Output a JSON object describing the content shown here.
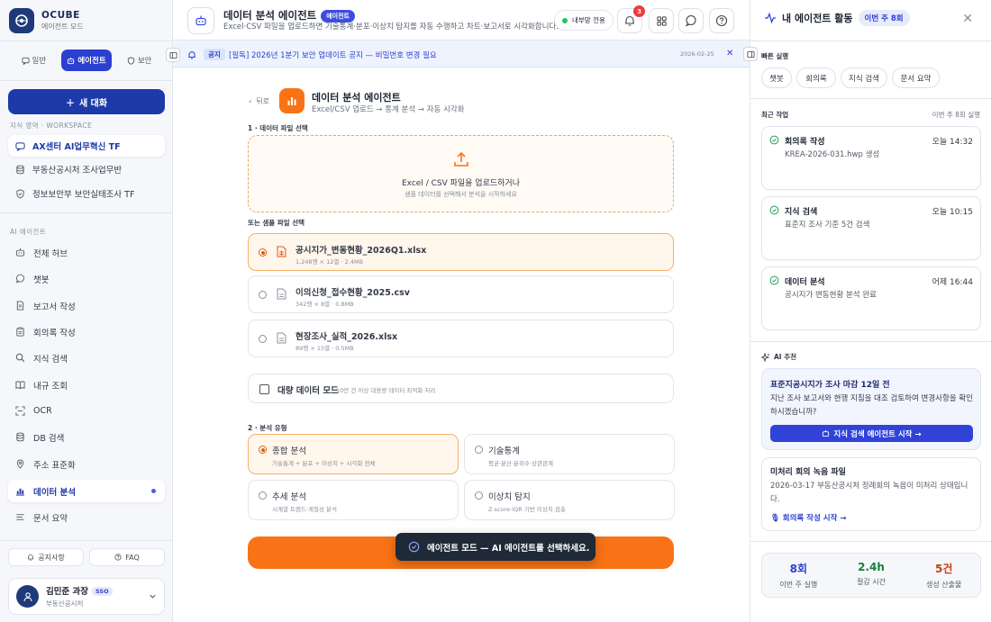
{
  "brand": {
    "name": "OCUBE",
    "subtitle": "에이전트 모드"
  },
  "sidebar": {
    "modes": [
      {
        "label": "일반",
        "icon": "chat-icon",
        "active": false
      },
      {
        "label": "에이전트",
        "icon": "robot-icon",
        "active": true
      },
      {
        "label": "보안",
        "icon": "shield-icon",
        "active": false
      }
    ],
    "new_chat_label": "새 대화",
    "workspace_label": "지식 영역 · WORKSPACE",
    "workspaces": [
      {
        "label": "AX센터 AI업무혁신 TF",
        "icon": "chat-icon",
        "active": true
      },
      {
        "label": "부동산공시처 조사업무반",
        "icon": "database-icon",
        "active": false
      },
      {
        "label": "정보보안부 보안실태조사 TF",
        "icon": "shield-icon",
        "active": false
      }
    ],
    "agents_label": "AI 에이전트",
    "agents": [
      {
        "label": "전체 허브",
        "icon": "robot-icon"
      },
      {
        "label": "챗봇",
        "icon": "chat-icon"
      },
      {
        "label": "보고서 작성",
        "icon": "document-icon"
      },
      {
        "label": "회의록 작성",
        "icon": "clipboard-icon"
      },
      {
        "label": "지식 검색",
        "icon": "search-icon"
      },
      {
        "label": "내규 조회",
        "icon": "book-icon"
      },
      {
        "label": "OCR",
        "icon": "scan-icon"
      },
      {
        "label": "DB 검색",
        "icon": "database-icon"
      },
      {
        "label": "주소 표준화",
        "icon": "pin-icon"
      },
      {
        "label": "데이터 분석",
        "icon": "chart-icon"
      },
      {
        "label": "문서 요약",
        "icon": "lines-icon"
      }
    ],
    "bottom_buttons": [
      {
        "label": "공지사항",
        "icon": "bell-icon"
      },
      {
        "label": "FAQ",
        "icon": "help-icon"
      }
    ],
    "user": {
      "name": "김민준 과장",
      "badge": "SSO",
      "org": "부동산공시처"
    }
  },
  "header": {
    "title": "데이터 분석 에이전트",
    "badge": "에이전트",
    "subtitle": "Excel·CSV 파일을 업로드하면 기술통계·분포·이상치 탐지를 자동 수행하고 차트·보고서로 시각화합니다.",
    "network": "내부망 전용",
    "notif_count": "3"
  },
  "notice": {
    "tag": "공지",
    "text": "[필독] 2026년 1분기 보안 업데이트 공지 — 비밀번호 변경 필요",
    "date": "2026-02-25"
  },
  "main": {
    "back_label": "뒤로",
    "title": "데이터 분석 에이전트",
    "subtitle": "Excel/CSV 업로드 → 통계 분석 → 자동 시각화",
    "step1_label": "1 · 데이터 파일 선택",
    "upload_title": "Excel / CSV 파일을 업로드하거나",
    "upload_sub": "샘플 데이터를 선택해서 분석을 시작하세요",
    "sample_label": "또는 샘플 파일 선택",
    "files": [
      {
        "name": "공시지가_변동현황_2026Q1.xlsx",
        "meta": "1,248행 × 12열 · 2.4MB",
        "selected": true
      },
      {
        "name": "이의신청_접수현황_2025.csv",
        "meta": "342행 × 8열 · 0.8MB",
        "selected": false
      },
      {
        "name": "현장조사_실적_2026.xlsx",
        "meta": "89행 × 15열 · 0.5MB",
        "selected": false
      }
    ],
    "bulk_title": "대량 데이터 모드",
    "bulk_sub": "10만 건 이상 대용량 데이터 최적화 처리",
    "step2_label": "2 · 분석 유형",
    "analysis_types": [
      {
        "name": "종합 분석",
        "desc": "기술통계 + 분포 + 이상치 + 시각화 전체",
        "selected": true
      },
      {
        "name": "기술통계",
        "desc": "평균·분산·분위수·상관관계",
        "selected": false
      },
      {
        "name": "추세 분석",
        "desc": "시계열 트렌드·계절성 분석",
        "selected": false
      },
      {
        "name": "이상치 탐지",
        "desc": "Z-score·IQR 기반 이상치 검출",
        "selected": false
      }
    ],
    "toast": "에이전트 모드 — AI 에이전트를 선택하세요."
  },
  "right": {
    "title": "내 에이전트 활동",
    "week_badge": "이번 주 8회",
    "quick_label": "빠른 실행",
    "quick_actions": [
      "챗봇",
      "회의록",
      "지식 검색",
      "문서 요약"
    ],
    "recent_label": "최근 작업",
    "recent_count": "이번 주 8회 실행",
    "activities": [
      {
        "title": "회의록 작성",
        "time": "오늘 14:32",
        "desc": "KREA-2026-031.hwp 생성"
      },
      {
        "title": "지식 검색",
        "time": "오늘 10:15",
        "desc": "표준지 조사 기준 5건 검색"
      },
      {
        "title": "데이터 분석",
        "time": "어제 16:44",
        "desc": "공시지가 변동현황 분석 완료"
      }
    ],
    "ai_label": "AI 추천",
    "rec1": {
      "title": "표준지공시지가 조사 마감 12일 전",
      "desc": "지난 조사 보고서와 현행 지침을 대조 검토하여 변경사항을 확인하시겠습니까?",
      "button": "지식 검색 에이전트 시작 →"
    },
    "rec2": {
      "title": "미처리 회의 녹음 파일",
      "desc": "2026-03-17 부동산공시처 정례회의 녹음이 미처리 상태입니다.",
      "link": "회의록 작성 시작 →"
    },
    "stats": [
      {
        "value": "8회",
        "label": "이번 주 실행",
        "color": "#2b3fd0"
      },
      {
        "value": "2.4h",
        "label": "절감 시간",
        "color": "#15803d"
      },
      {
        "value": "5건",
        "label": "생성 산출물",
        "color": "#c2410c"
      }
    ]
  }
}
